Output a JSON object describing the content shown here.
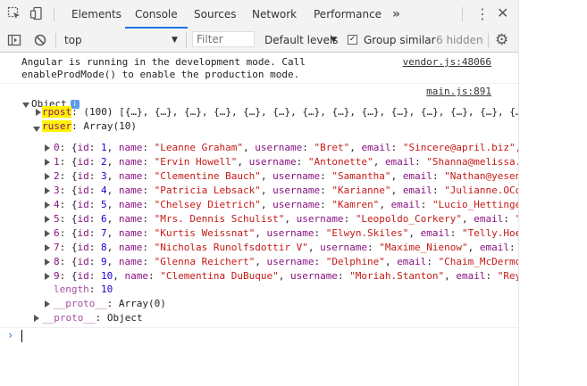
{
  "tabs": {
    "elements": "Elements",
    "console": "Console",
    "sources": "Sources",
    "network": "Network",
    "performance": "Performance",
    "more": "»"
  },
  "toolbar": {
    "context": "top",
    "filter_placeholder": "Filter",
    "levels": "Default levels",
    "group_similar": "Group similar",
    "hidden": "6 hidden"
  },
  "messages": {
    "angular_line1": "Angular is running in the development mode. Call",
    "angular_line2": "enableProdMode() to enable the production mode.",
    "angular_src": "vendor.js:48066",
    "main_src": "main.js:891"
  },
  "object": {
    "label": "Object",
    "rpost_key": "rpost",
    "rpost_val": "(100) [{…}, {…}, {…}, {…}, {…}, {…}, {…}, {…}, {…}, {…}, {…}, {…}, {…}, {…",
    "ruser_key": "ruser",
    "ruser_val": "Array(10)",
    "users": [
      {
        "idx": "0",
        "id": "1",
        "name": "\"Leanne Graham\"",
        "username": "\"Bret\"",
        "email": "\"Sincere@april.biz\","
      },
      {
        "idx": "1",
        "id": "2",
        "name": "\"Ervin Howell\"",
        "username": "\"Antonette\"",
        "email": "\"Shanna@melissa."
      },
      {
        "idx": "2",
        "id": "3",
        "name": "\"Clementine Bauch\"",
        "username": "\"Samantha\"",
        "email": "\"Nathan@yesen"
      },
      {
        "idx": "3",
        "id": "4",
        "name": "\"Patricia Lebsack\"",
        "username": "\"Karianne\"",
        "email": "\"Julianne.OCo"
      },
      {
        "idx": "4",
        "id": "5",
        "name": "\"Chelsey Dietrich\"",
        "username": "\"Kamren\"",
        "email": "\"Lucio_Hettinge"
      },
      {
        "idx": "5",
        "id": "6",
        "name": "\"Mrs. Dennis Schulist\"",
        "username": "\"Leopoldo_Corkery\"",
        "email": "\""
      },
      {
        "idx": "6",
        "id": "7",
        "name": "\"Kurtis Weissnat\"",
        "username": "\"Elwyn.Skiles\"",
        "email": "\"Telly.Hoe"
      },
      {
        "idx": "7",
        "id": "8",
        "name": "\"Nicholas Runolfsdottir V\"",
        "username": "\"Maxime_Nienow\"",
        "email": ""
      },
      {
        "idx": "8",
        "id": "9",
        "name": "\"Glenna Reichert\"",
        "username": "\"Delphine\"",
        "email": "\"Chaim_McDermo"
      },
      {
        "idx": "9",
        "id": "10",
        "name": "\"Clementina DuBuque\"",
        "username": "\"Moriah.Stanton\"",
        "email": "\"Rey"
      }
    ],
    "length_key": "length",
    "length_val": "10",
    "proto_inner_key": "__proto__",
    "proto_inner_val": "Array(0)",
    "proto_outer_key": "__proto__",
    "proto_outer_val": "Object"
  },
  "prompt_symbol": "›",
  "icons": {
    "inspect": "inspect-element-icon",
    "device": "device-toolbar-icon",
    "sidebar": "console-sidebar-icon",
    "clear": "clear-console-icon",
    "settings": "gear-icon",
    "menu": "kebab-menu-icon",
    "close": "close-icon"
  },
  "colors": {
    "active_tab": "#1a73e8",
    "key": "#881280",
    "string": "#c41a16",
    "number": "#1c00cf",
    "highlight": "#fff200"
  }
}
